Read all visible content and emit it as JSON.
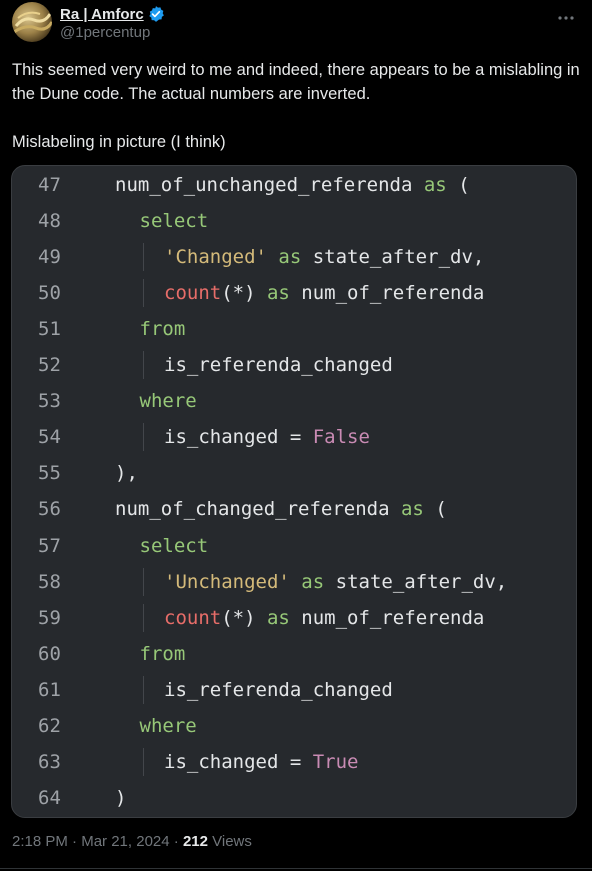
{
  "author": {
    "display_name": "Ra | Amforc",
    "handle": "@1percentup",
    "verified_color": "#1d9bf0",
    "avatar_icon": "avatar-image"
  },
  "tweet": {
    "paragraphs": [
      "This seemed very weird to me and indeed, there appears to be a mislabling in the Dune code. The actual numbers are inverted.",
      "Mislabeling in picture (I think)"
    ]
  },
  "code_image": {
    "background": "#26292d",
    "lines": [
      {
        "no": "47",
        "indent": 0,
        "tokens": [
          [
            "plain",
            "num_of_unchanged_referenda "
          ],
          [
            "kw",
            "as"
          ],
          [
            "plain",
            " ("
          ]
        ]
      },
      {
        "no": "48",
        "indent": 1,
        "tokens": [
          [
            "kw",
            "select"
          ]
        ]
      },
      {
        "no": "49",
        "indent": 2,
        "tokens": [
          [
            "str",
            "'Changed'"
          ],
          [
            "plain",
            " "
          ],
          [
            "kw",
            "as"
          ],
          [
            "plain",
            " state_after_dv,"
          ]
        ]
      },
      {
        "no": "50",
        "indent": 2,
        "tokens": [
          [
            "fn",
            "count"
          ],
          [
            "plain",
            "(*) "
          ],
          [
            "kw",
            "as"
          ],
          [
            "plain",
            " num_of_referenda"
          ]
        ]
      },
      {
        "no": "51",
        "indent": 1,
        "tokens": [
          [
            "kw",
            "from"
          ]
        ]
      },
      {
        "no": "52",
        "indent": 2,
        "tokens": [
          [
            "plain",
            "is_referenda_changed"
          ]
        ]
      },
      {
        "no": "53",
        "indent": 1,
        "tokens": [
          [
            "kw",
            "where"
          ]
        ]
      },
      {
        "no": "54",
        "indent": 2,
        "tokens": [
          [
            "plain",
            "is_changed = "
          ],
          [
            "bool",
            "False"
          ]
        ]
      },
      {
        "no": "55",
        "indent": 0,
        "tokens": [
          [
            "plain",
            "),"
          ]
        ]
      },
      {
        "no": "56",
        "indent": 0,
        "tokens": [
          [
            "plain",
            "num_of_changed_referenda "
          ],
          [
            "kw",
            "as"
          ],
          [
            "plain",
            " ("
          ]
        ]
      },
      {
        "no": "57",
        "indent": 1,
        "tokens": [
          [
            "kw",
            "select"
          ]
        ]
      },
      {
        "no": "58",
        "indent": 2,
        "tokens": [
          [
            "str",
            "'Unchanged'"
          ],
          [
            "plain",
            " "
          ],
          [
            "kw",
            "as"
          ],
          [
            "plain",
            " state_after_dv,"
          ]
        ]
      },
      {
        "no": "59",
        "indent": 2,
        "tokens": [
          [
            "fn",
            "count"
          ],
          [
            "plain",
            "(*) "
          ],
          [
            "kw",
            "as"
          ],
          [
            "plain",
            " num_of_referenda"
          ]
        ]
      },
      {
        "no": "60",
        "indent": 1,
        "tokens": [
          [
            "kw",
            "from"
          ]
        ]
      },
      {
        "no": "61",
        "indent": 2,
        "tokens": [
          [
            "plain",
            "is_referenda_changed"
          ]
        ]
      },
      {
        "no": "62",
        "indent": 1,
        "tokens": [
          [
            "kw",
            "where"
          ]
        ]
      },
      {
        "no": "63",
        "indent": 2,
        "tokens": [
          [
            "plain",
            "is_changed = "
          ],
          [
            "bool",
            "True"
          ]
        ]
      },
      {
        "no": "64",
        "indent": 0,
        "tokens": [
          [
            "plain",
            ")"
          ]
        ]
      }
    ]
  },
  "meta": {
    "time": "2:18 PM",
    "separator": " · ",
    "date": "Mar 21, 2024",
    "views_count": "212",
    "views_label": " Views"
  }
}
